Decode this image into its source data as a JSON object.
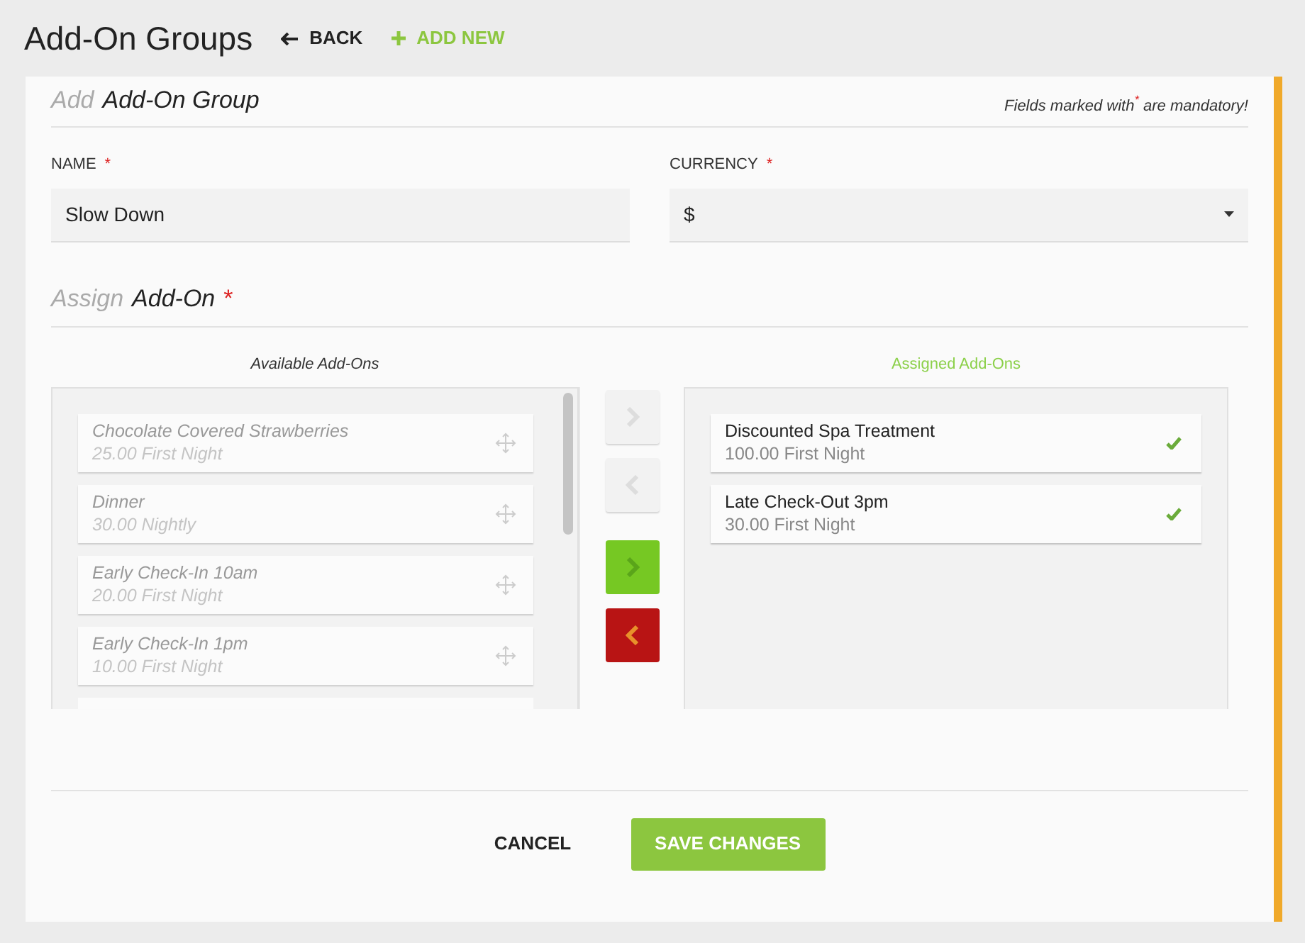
{
  "header": {
    "title": "Add-On Groups",
    "back_label": "BACK",
    "add_new_label": "ADD NEW"
  },
  "form_heading": {
    "prefix": "Add",
    "title": "Add-On Group",
    "note": "Fields marked with$^{*}$ are mandatory!"
  },
  "fields": [
    {
      "label": "NAME",
      "required_mark": "*",
      "kind": "text",
      "value": "Slow Down"
    },
    {
      "label": "CURRENCY",
      "required_mark": "*",
      "kind": "select",
      "value": "$"
    }
  ],
  "assign_heading": {
    "prefix": "Assign",
    "title": "Add-On",
    "required_mark": "*"
  },
  "available": {
    "title": "Available Add-Ons",
    "items": [
      {
        "name": "Chocolate Covered Strawberries",
        "price": "25.00 First Night"
      },
      {
        "name": "Dinner",
        "price": "30.00 Nightly"
      },
      {
        "name": "Early Check-In 10am",
        "price": "20.00 First Night"
      },
      {
        "name": "Early Check-In 1pm",
        "price": "10.00 First Night"
      }
    ]
  },
  "move_buttons": [
    {
      "kind": "add",
      "enabled": false
    },
    {
      "kind": "remove",
      "enabled": false
    },
    {
      "kind": "add",
      "enabled": true
    },
    {
      "kind": "remove",
      "enabled": true
    }
  ],
  "assigned": {
    "title": "Assigned Add-Ons",
    "items": [
      {
        "name": "Discounted Spa Treatment",
        "price": "100.00 First Night"
      },
      {
        "name": "Late Check-Out 3pm",
        "price": "30.00 First Night"
      }
    ]
  },
  "actions": {
    "cancel": "CANCEL",
    "save": "SAVE CHANGES"
  }
}
